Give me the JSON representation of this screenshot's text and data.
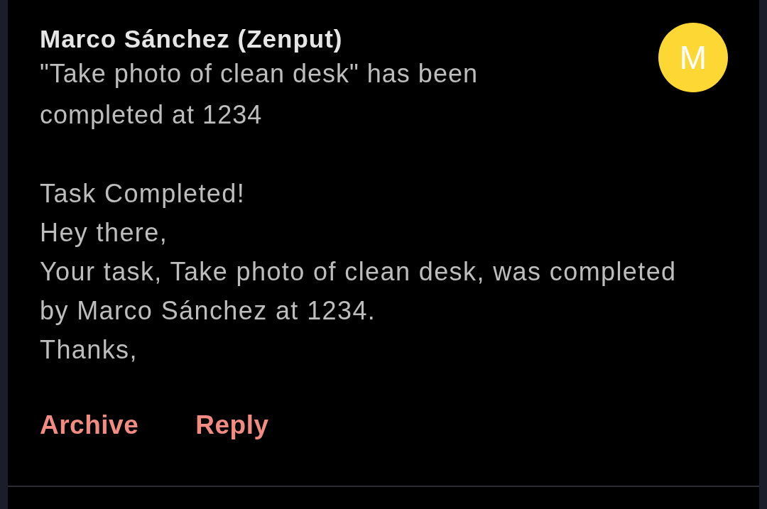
{
  "notification": {
    "sender": "Marco Sánchez (Zenput)",
    "subject": "\"Take photo of clean desk\" has been completed at 1234",
    "avatar": {
      "initial": "M"
    },
    "body": [
      "Task Completed!",
      "Hey there,",
      "Your task, Take photo of clean desk, was completed by Marco Sánchez at 1234.",
      "Thanks,"
    ],
    "actions": [
      {
        "label": "Archive"
      },
      {
        "label": "Reply"
      }
    ]
  }
}
